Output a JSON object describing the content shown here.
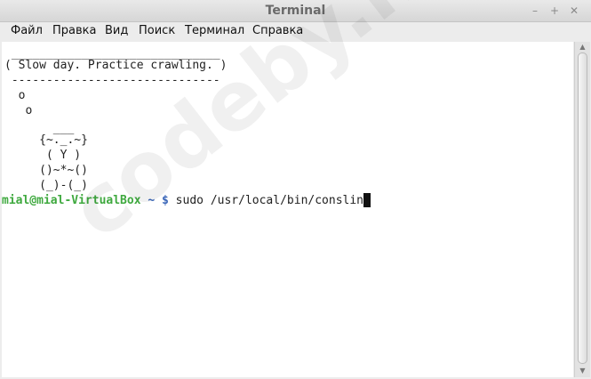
{
  "window": {
    "title": "Terminal"
  },
  "titlebar_buttons": {
    "minimize": "–",
    "maximize": "+",
    "close": "✕"
  },
  "menu": [
    {
      "label": "Файл"
    },
    {
      "label": "Правка"
    },
    {
      "label": "Вид"
    },
    {
      "label": "Поиск"
    },
    {
      "label": "Терминал"
    },
    {
      "label": "Справка"
    }
  ],
  "terminal": {
    "lines": [
      " ______________________________",
      "( Slow day. Practice crawling. )",
      " ------------------------------",
      "  o",
      "   o",
      "",
      "       ___",
      "     {~._.~}",
      "      ( Y )",
      "     ()~*~()",
      "     (_)-(_)"
    ],
    "prompt_user": "mial@mial-VirtualBox",
    "prompt_tilde": "~ $",
    "command": " sudo /usr/local/bin/conslin"
  },
  "watermark": "codeby.net",
  "colors": {
    "prompt_user": "#3fa93f",
    "prompt_path": "#3a66b8",
    "terminal_bg": "#ffffff"
  }
}
